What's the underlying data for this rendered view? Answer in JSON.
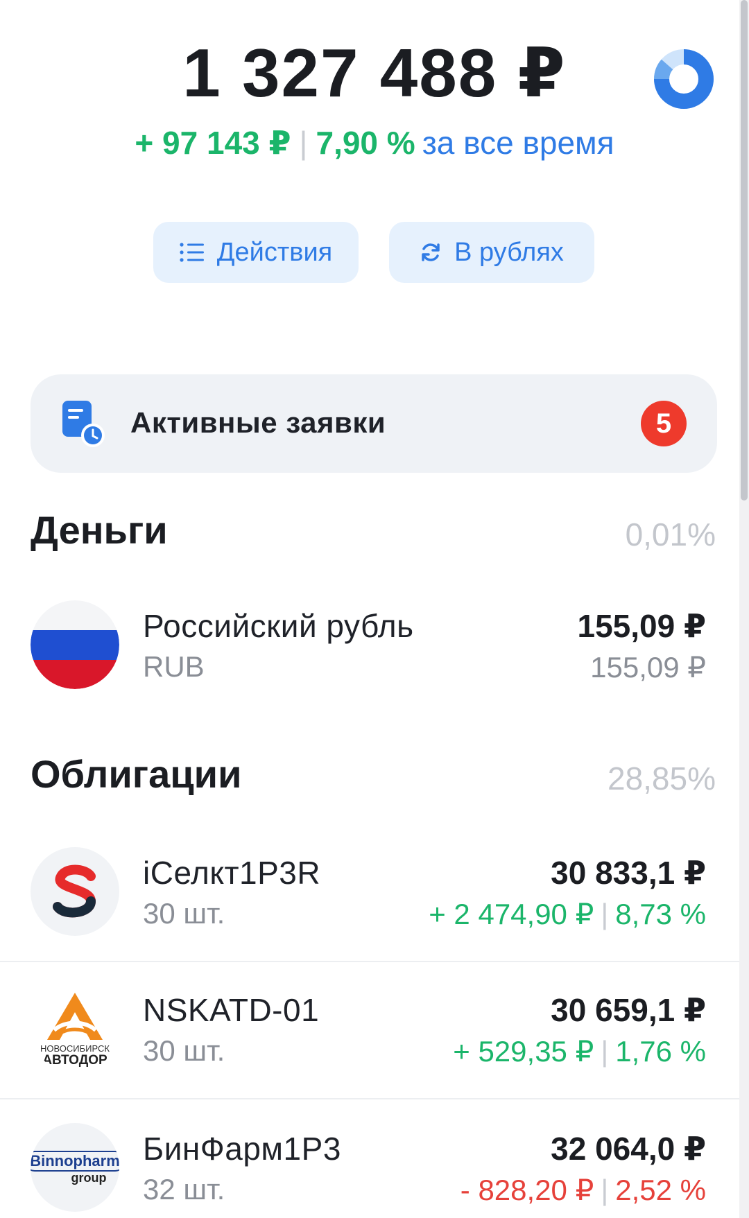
{
  "header": {
    "total": "1 327 488 ₽",
    "profit_abs": "+ 97 143 ₽",
    "profit_pct": "7,90 %",
    "profit_period": "за все время"
  },
  "buttons": {
    "actions_label": "Действия",
    "currency_label": "В рублях"
  },
  "orders": {
    "title": "Активные заявки",
    "count": "5"
  },
  "sections": {
    "money": {
      "title": "Деньги",
      "share": "0,01%",
      "items": [
        {
          "name": "Российский рубль",
          "ticker": "RUB",
          "value": "155,09 ₽",
          "sub_value": "155,09 ₽"
        }
      ]
    },
    "bonds": {
      "title": "Облигации",
      "share": "28,85%",
      "items": [
        {
          "name": "iСелкт1Р3R",
          "qty": "30 шт.",
          "value": "30 833,1 ₽",
          "change_abs": "+ 2 474,90 ₽",
          "change_pct": "8,73 %",
          "logo_text": "S"
        },
        {
          "name": "NSKATD-01",
          "qty": "30 шт.",
          "value": "30 659,1 ₽",
          "change_abs": "+ 529,35 ₽",
          "change_pct": "1,76 %",
          "logo_line1": "НОВОСИБИРСК",
          "logo_line2": "АВТОДОР"
        },
        {
          "name": "БинФарм1Р3",
          "qty": "32 шт.",
          "value": "32 064,0 ₽",
          "change_abs": "- 828,20 ₽",
          "change_pct": "2,52 %",
          "logo_line1": "Binnopharm",
          "logo_line2": "group"
        }
      ]
    }
  },
  "colors": {
    "positive": "#1bb56a",
    "negative": "#e6413a",
    "accent": "#2f7be5",
    "badge": "#ee3a2c"
  },
  "icons": {
    "portfolio_chart": "pie-chart-icon",
    "actions": "list-icon",
    "currency": "refresh-icon",
    "orders": "document-clock-icon"
  }
}
